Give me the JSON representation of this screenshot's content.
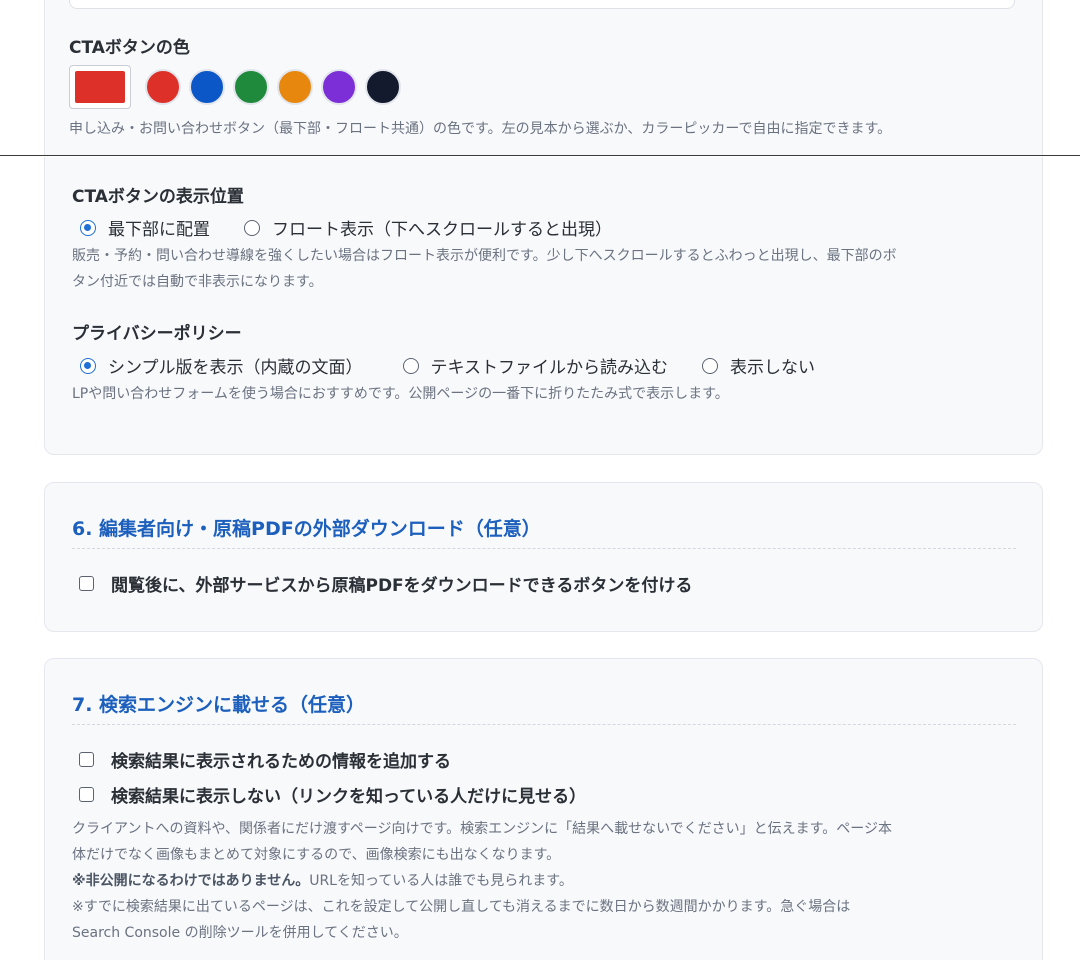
{
  "cta_color": {
    "label": "CTAボタンの色",
    "selected_color": "#dc3028",
    "presets": [
      "#dc3028",
      "#0b57c8",
      "#1f8a3b",
      "#e8870e",
      "#7c2fd6",
      "#141a2e"
    ],
    "help": "申し込み・お問い合わせボタン（最下部・フロート共通）の色です。左の見本から選ぶか、カラーピッカーで自由に指定できます。"
  },
  "cta_position": {
    "label": "CTAボタンの表示位置",
    "options": [
      "最下部に配置",
      "フロート表示（下へスクロールすると出現）"
    ],
    "selected": 0,
    "help_line1": "販売・予約・問い合わせ導線を強くしたい場合はフロート表示が便利です。少し下へスクロールするとふわっと出現し、最下部のボ",
    "help_line2": "タン付近では自動で非表示になります。"
  },
  "privacy": {
    "label": "プライバシーポリシー",
    "options": [
      "シンプル版を表示（内蔵の文面）",
      "テキストファイルから読み込む",
      "表示しない"
    ],
    "selected": 0,
    "help": "LPや問い合わせフォームを使う場合におすすめです。公開ページの一番下に折りたたみ式で表示します。"
  },
  "section6": {
    "title": "6. 編集者向け・原稿PDFの外部ダウンロード（任意）",
    "checkbox_label": "閲覧後に、外部サービスから原稿PDFをダウンロードできるボタンを付ける",
    "checked": false
  },
  "section7": {
    "title": "7. 検索エンジンに載せる（任意）",
    "checkbox1_label": "検索結果に表示されるための情報を追加する",
    "checkbox1_checked": false,
    "checkbox2_label": "検索結果に表示しない（リンクを知っている人だけに見せる）",
    "checkbox2_checked": false,
    "help_line1": "クライアントへの資料や、関係者にだけ渡すページ向けです。検索エンジンに「結果へ載せないでください」と伝えます。ページ本",
    "help_line2": "体だけでなく画像もまとめて対象にするので、画像検索にも出なくなります。",
    "help_note_bold": "※非公開になるわけではありません。",
    "help_note_rest": "URLを知っている人は誰でも見られます。",
    "help_line4": "※すでに検索結果に出ているページは、これを設定して公開し直しても消えるまでに数日から数週間かかります。急ぐ場合は",
    "help_line5": "Search Console の削除ツールを併用してください。"
  }
}
